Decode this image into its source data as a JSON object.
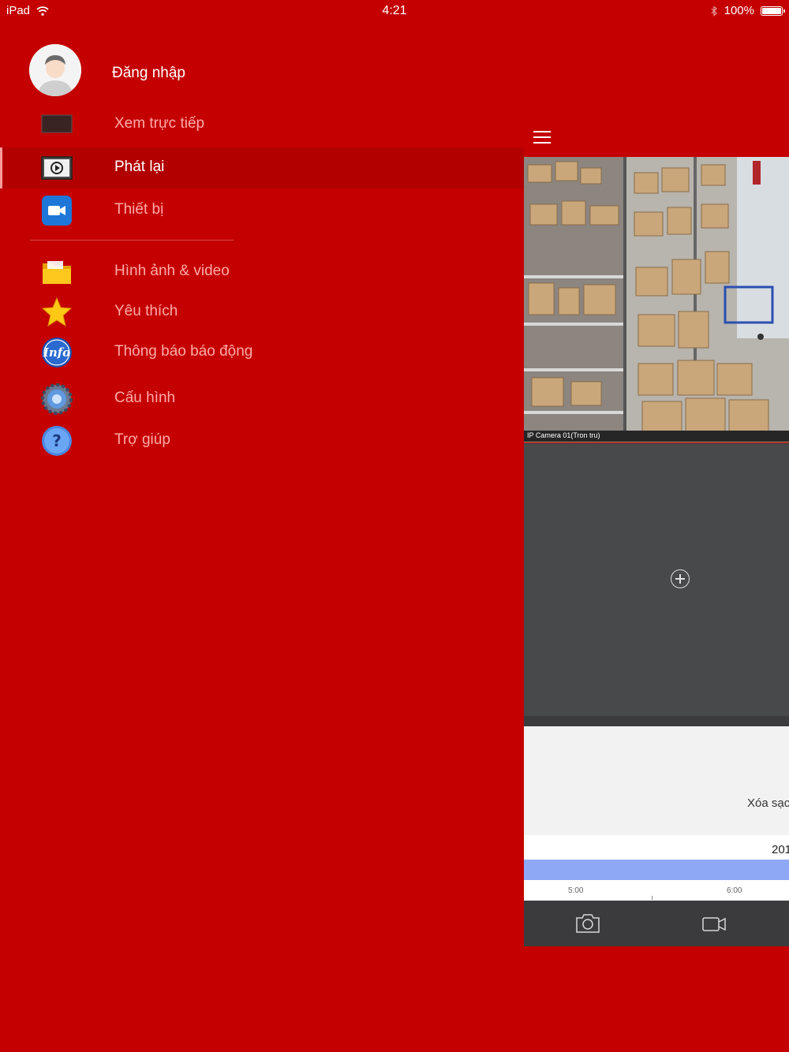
{
  "status_bar": {
    "device": "iPad",
    "time": "4:21",
    "battery": "100%",
    "battery_level": 1.0
  },
  "menu": {
    "login_label": "Đăng nhập",
    "items": [
      {
        "label": "Xem trực tiếp",
        "icon": "monitor-icon",
        "active": false
      },
      {
        "label": "Phát lại",
        "icon": "playback-icon",
        "active": true
      },
      {
        "label": "Thiết bị",
        "icon": "video-camera-icon",
        "active": false
      },
      {
        "label": "Hình ảnh & video",
        "icon": "folder-icon",
        "active": false
      },
      {
        "label": "Yêu thích",
        "icon": "star-icon",
        "active": false
      },
      {
        "label": "Thông báo báo động",
        "icon": "info-icon",
        "active": false
      },
      {
        "label": "Cấu hình",
        "icon": "gear-icon",
        "active": false
      },
      {
        "label": "Trợ giúp",
        "icon": "help-icon",
        "active": false
      }
    ]
  },
  "playback": {
    "camera_label": "IP Camera 01(Tron tru)",
    "clear_text": "Xóa sạc",
    "date_text": "201",
    "timeline_ticks": [
      "5:00",
      "6:00"
    ]
  },
  "colors": {
    "accent": "#c40000",
    "active_row": "#b20000",
    "timeline": "#8fa8f6",
    "toolbar": "#3b3b3d"
  }
}
